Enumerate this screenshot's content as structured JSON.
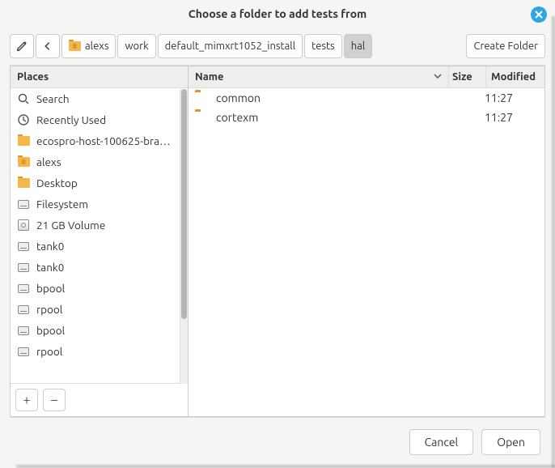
{
  "title": "Choose a folder to add tests from",
  "path": {
    "segments": [
      {
        "label": "alexs",
        "home": true
      },
      {
        "label": "work"
      },
      {
        "label": "default_mimxrt1052_install"
      },
      {
        "label": "tests"
      },
      {
        "label": "hal",
        "active": true
      }
    ]
  },
  "create_folder_label": "Create Folder",
  "sidebar": {
    "header": "Places",
    "places": [
      {
        "icon": "search",
        "label": "Search"
      },
      {
        "icon": "clock",
        "label": "Recently Used"
      },
      {
        "icon": "folder",
        "label": "ecospro-host-100625-bra…"
      },
      {
        "icon": "home",
        "label": "alexs"
      },
      {
        "icon": "folder",
        "label": "Desktop"
      },
      {
        "icon": "drive",
        "label": "Filesystem"
      },
      {
        "icon": "disk",
        "label": "21 GB Volume"
      },
      {
        "icon": "drive",
        "label": "tank0"
      },
      {
        "icon": "drive",
        "label": "tank0"
      },
      {
        "icon": "drive",
        "label": "bpool"
      },
      {
        "icon": "drive",
        "label": "rpool"
      },
      {
        "icon": "drive",
        "label": "bpool"
      },
      {
        "icon": "drive",
        "label": "rpool"
      }
    ],
    "add_label": "+",
    "remove_label": "–"
  },
  "columns": {
    "name": "Name",
    "size": "Size",
    "modified": "Modified"
  },
  "files": [
    {
      "name": "common",
      "size": "",
      "modified": "11:27"
    },
    {
      "name": "cortexm",
      "size": "",
      "modified": "11:27"
    }
  ],
  "footer": {
    "cancel": "Cancel",
    "open": "Open"
  }
}
